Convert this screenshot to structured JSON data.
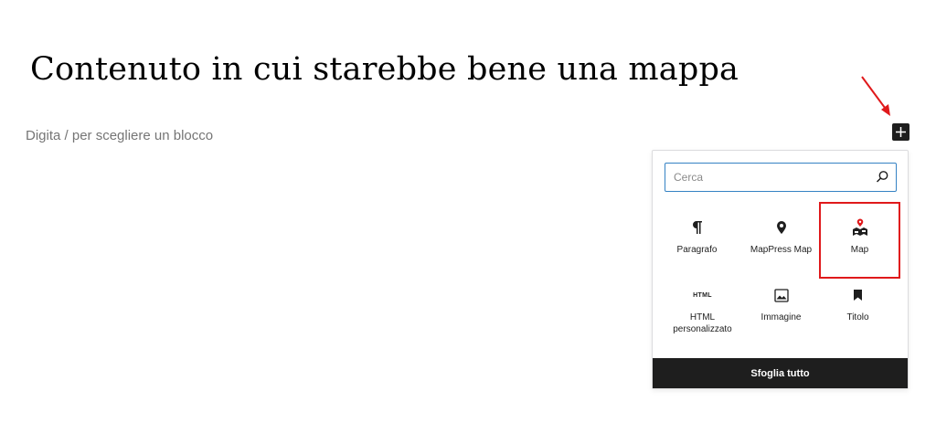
{
  "editor": {
    "post_title": "Contenuto in cui starebbe bene una mappa",
    "block_placeholder": "Digita / per scegliere un blocco"
  },
  "inserter": {
    "toggle_icon": "plus-icon",
    "search": {
      "placeholder": "Cerca",
      "value": ""
    },
    "blocks": [
      {
        "label": "Paragrafo",
        "icon": "paragraph-icon"
      },
      {
        "label": "MapPress Map",
        "icon": "map-pin-icon"
      },
      {
        "label": "Map",
        "icon": "map-marker-icon",
        "highlighted": true
      },
      {
        "label": "HTML personalizzato",
        "icon": "html-icon",
        "icon_text": "HTML"
      },
      {
        "label": "Immagine",
        "icon": "image-icon"
      },
      {
        "label": "Titolo",
        "icon": "bookmark-icon"
      }
    ],
    "browse_all_label": "Sfoglia tutto"
  },
  "colors": {
    "annotation": "#e0191b",
    "dark": "#1e1e1e",
    "focus_blue": "#3582c4",
    "placeholder_gray": "#757575"
  }
}
